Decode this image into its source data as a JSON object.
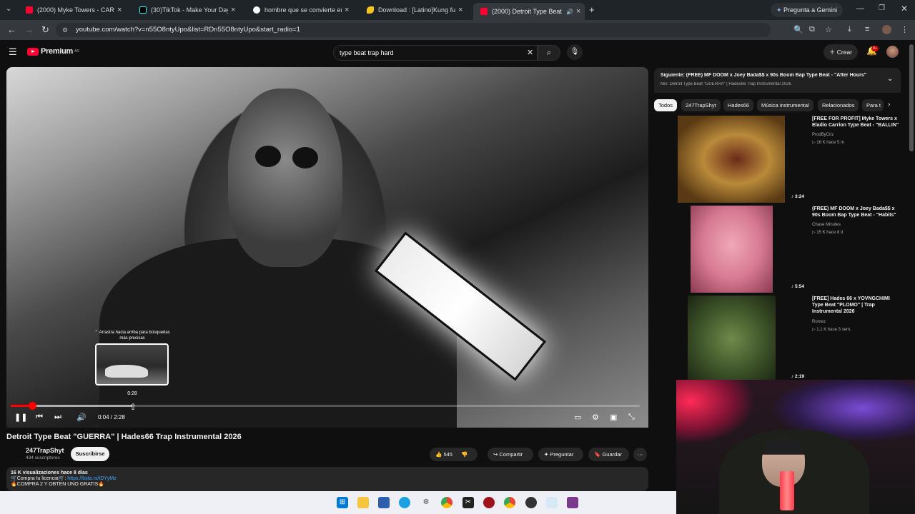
{
  "browser": {
    "tabs": [
      {
        "title": "(2000) Myke Towers - CARITA F",
        "favicon_color": "#ff0033"
      },
      {
        "title": "(30)TikTok - Make Your Day",
        "favicon_color": "#000000"
      },
      {
        "title": "hombre que se convierte en ra",
        "favicon_color": "#4285f4"
      },
      {
        "title": "Download : [Latino]Kung fu pa",
        "favicon_color": "#f5c518"
      },
      {
        "title": "(2000) Detroit Type Beat \"G",
        "favicon_color": "#ff0033"
      }
    ],
    "new_tab": "+",
    "gemini_label": "Pregunta a Gemini",
    "url": "youtube.com/watch?v=n55O8ntyUpo&list=RDn55O8ntyUpo&start_radio=1"
  },
  "youtube": {
    "brand": "Premium",
    "brand_sup": "AR",
    "search_value": "type beat trap hard",
    "create_label": "Crear",
    "notif_count": "9+"
  },
  "player": {
    "hover_hint": "⌃ Arrastra hacia arriba para búsquedas más precisas",
    "hover_time": "0:28",
    "current_time": "0:04 / 2:28",
    "progress_fraction": 0.0338,
    "hover_fraction": 0.1934
  },
  "video": {
    "title": "Detroit Type Beat \"GUERRA\" | Hades66 Trap Instrumental 2026",
    "channel": "247TrapShyt",
    "subscribers": "434 suscriptores",
    "subscribe_label": "Suscribirse",
    "likes": "545",
    "share_label": "Compartir",
    "ask_label": "Preguntar",
    "save_label": "Guardar",
    "views_line": "16 K visualizaciones  hace 8 días",
    "license_prefix": "🛒Compra tu licencia🛒: ",
    "license_link": "https://bsta.rs/tDYyMz",
    "promo_line": "🔥COMPRA 2 Y OBTEN UNO GRATIS🔥"
  },
  "sidebar": {
    "next_label": "Siguiente: (FREE) MF DOOM x Joey Bada$$ x 90s Boom Bap Type Beat - \"After Hours\"",
    "mix_label": "Mix: Detroit Type Beat \"GUERRA\" | Hades66 Trap Instrumental 2026",
    "chips": [
      "Todos",
      "247TrapShyt",
      "Hades66",
      "Música instrumental",
      "Relacionados",
      "Para t"
    ],
    "recos": [
      {
        "title": "[FREE FOR PROFIT] Myke Towers x Eladio Carrion Type Beat - \"BALLIN\"",
        "channel": "ProdByCriz",
        "meta": "▷ 16 K  hace 5 m",
        "duration": "♪ 3:24"
      },
      {
        "title": "(FREE) MF DOOM x Joey Bada$$ x 90s Boom Bap Type Beat - \"Habits\"",
        "channel": "Chase Minutes",
        "meta": "▷ 15 K  hace 8 d",
        "duration": "♪ 5:54"
      },
      {
        "title": "[FREE]  Hades 66 x YOVNGCHIMI Type Beat \"PLOMO\" | Trap Instrumental 2026",
        "channel": "Romez",
        "meta": "▷ 1,1 K  hace 3 sem.",
        "duration": "♪ 2:19"
      }
    ]
  },
  "colors": {
    "accent": "#ff0033",
    "bg": "#0f0f0f"
  }
}
